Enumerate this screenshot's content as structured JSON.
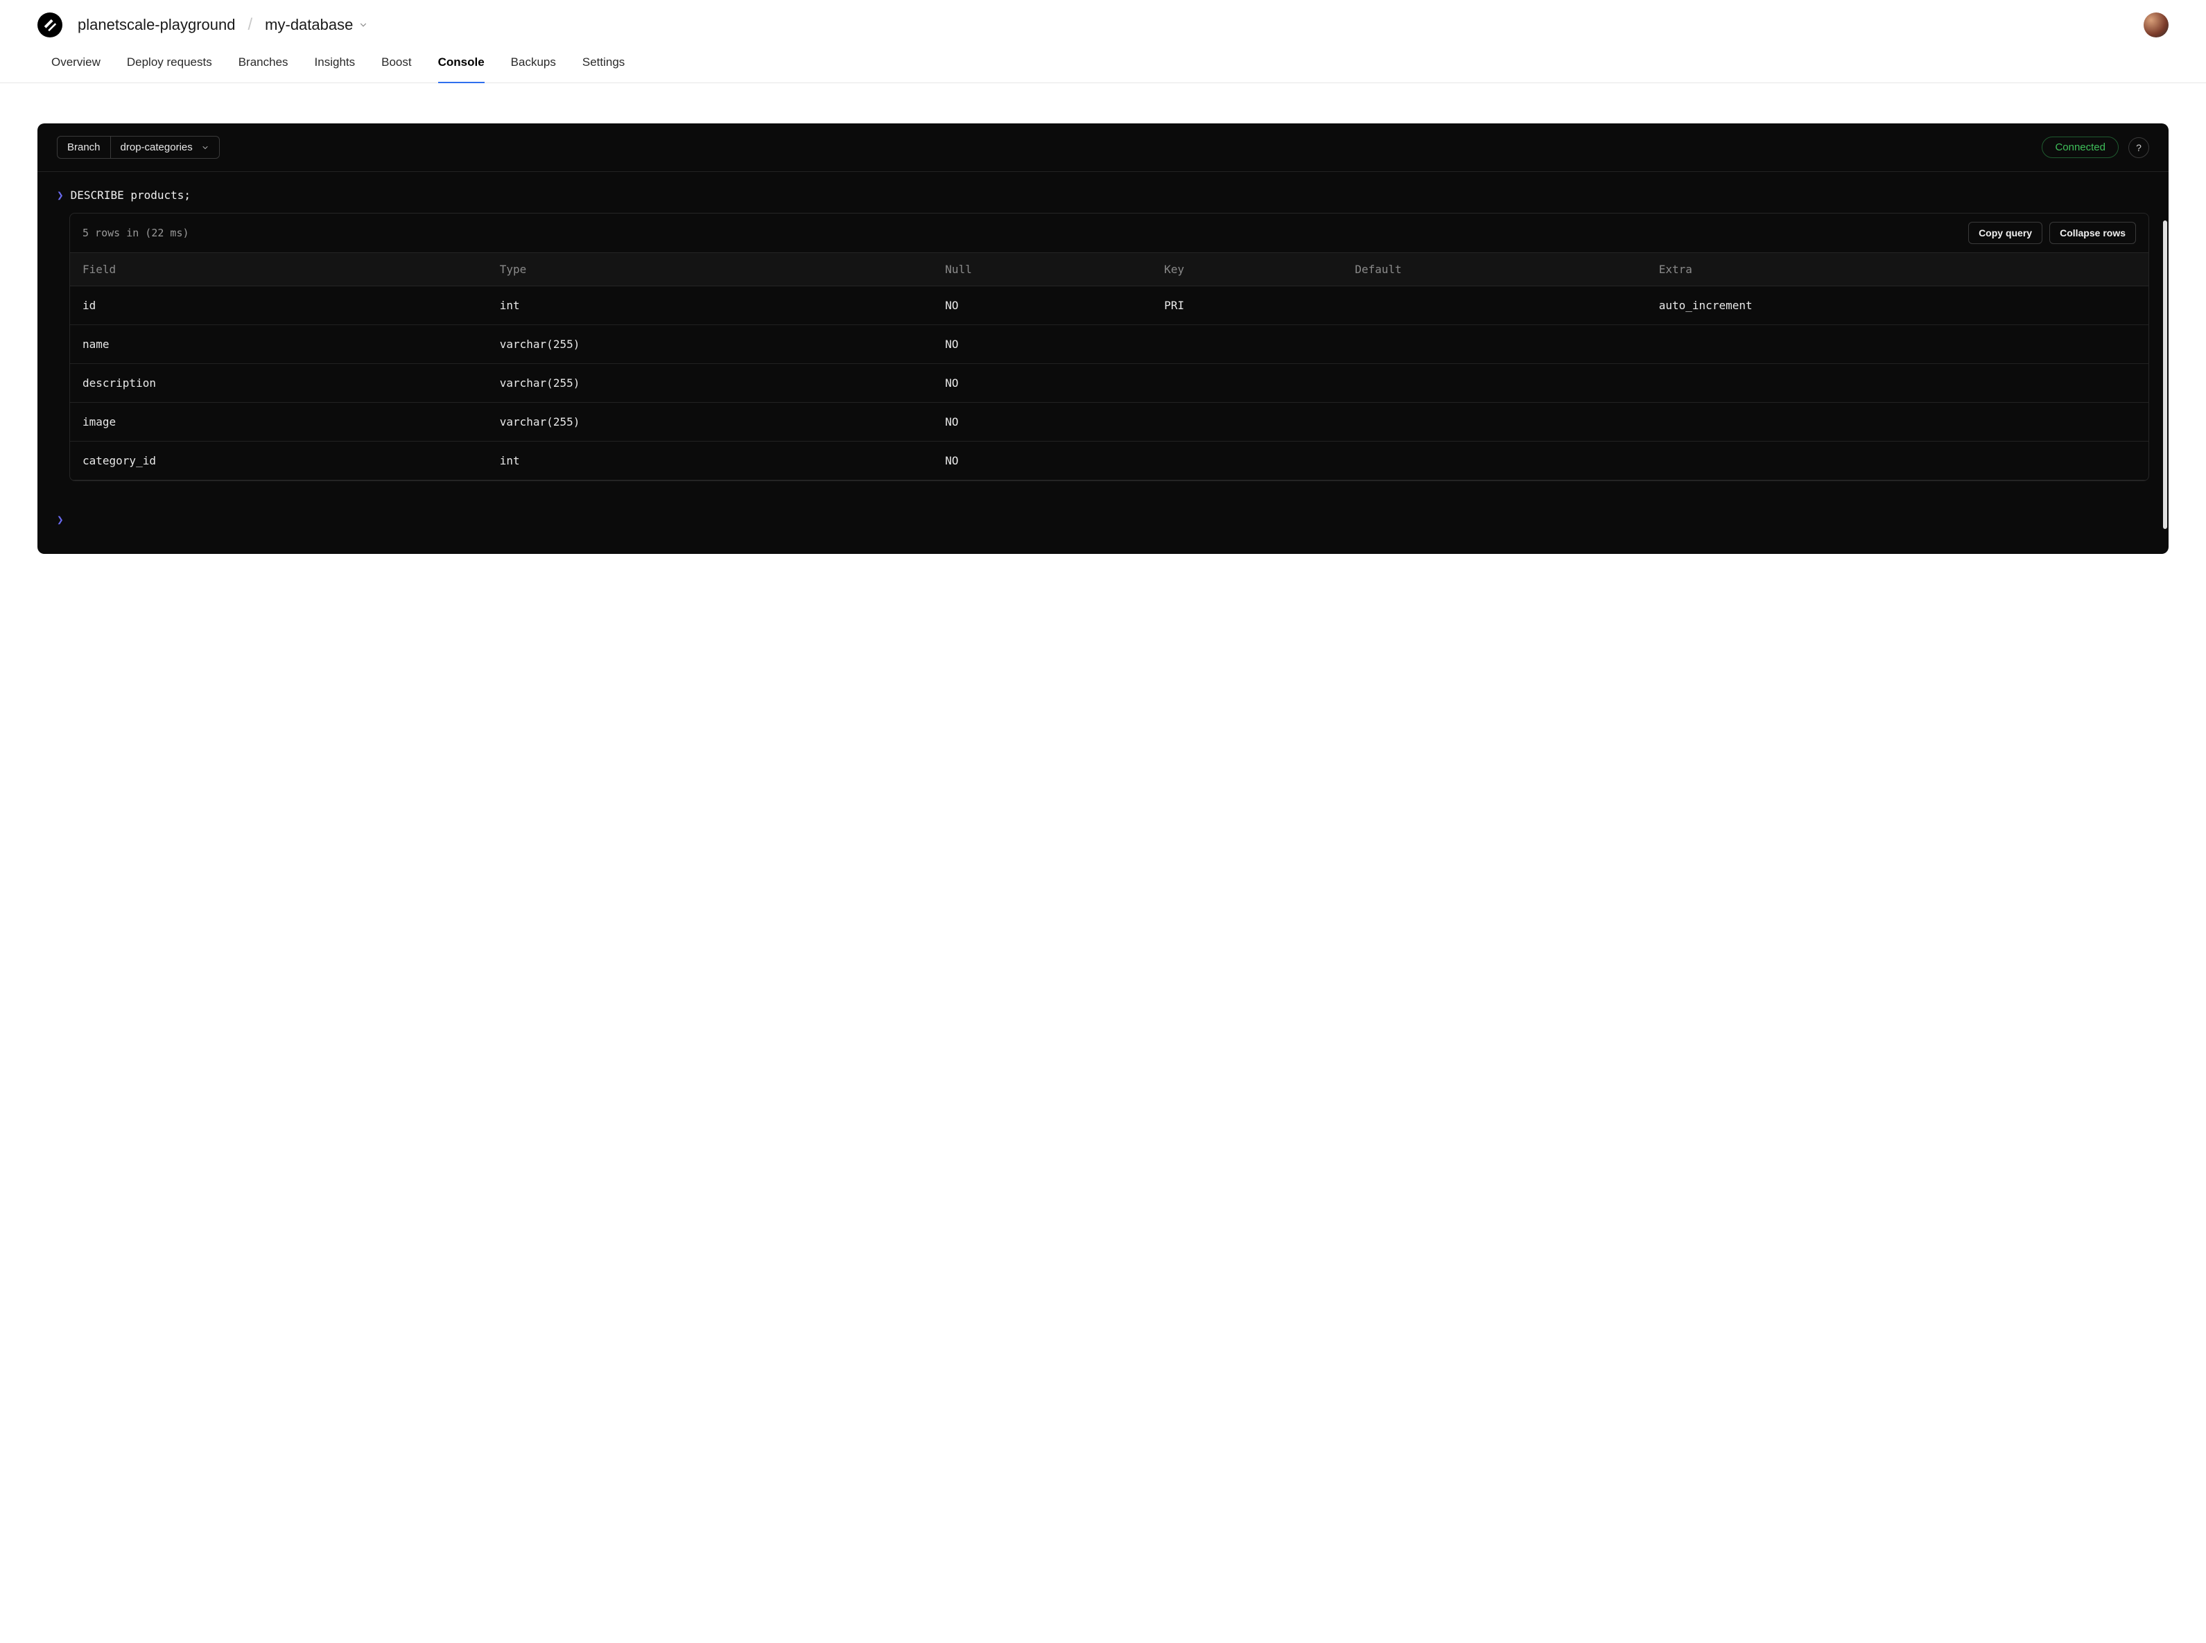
{
  "header": {
    "org": "planetscale-playground",
    "database": "my-database"
  },
  "tabs": [
    {
      "label": "Overview",
      "active": false
    },
    {
      "label": "Deploy requests",
      "active": false
    },
    {
      "label": "Branches",
      "active": false
    },
    {
      "label": "Insights",
      "active": false
    },
    {
      "label": "Boost",
      "active": false
    },
    {
      "label": "Console",
      "active": true
    },
    {
      "label": "Backups",
      "active": false
    },
    {
      "label": "Settings",
      "active": false
    }
  ],
  "console": {
    "branch_label": "Branch",
    "branch_value": "drop-categories",
    "status": "Connected",
    "query": "DESCRIBE products;",
    "result_summary": "5 rows in (22 ms)",
    "copy_query_label": "Copy query",
    "collapse_rows_label": "Collapse rows",
    "columns": [
      "Field",
      "Type",
      "Null",
      "Key",
      "Default",
      "Extra"
    ],
    "rows": [
      {
        "Field": "id",
        "Type": "int",
        "Null": "NO",
        "Key": "PRI",
        "Default": "",
        "Extra": "auto_increment"
      },
      {
        "Field": "name",
        "Type": "varchar(255)",
        "Null": "NO",
        "Key": "",
        "Default": "",
        "Extra": ""
      },
      {
        "Field": "description",
        "Type": "varchar(255)",
        "Null": "NO",
        "Key": "",
        "Default": "",
        "Extra": ""
      },
      {
        "Field": "image",
        "Type": "varchar(255)",
        "Null": "NO",
        "Key": "",
        "Default": "",
        "Extra": ""
      },
      {
        "Field": "category_id",
        "Type": "int",
        "Null": "NO",
        "Key": "",
        "Default": "",
        "Extra": ""
      }
    ]
  }
}
